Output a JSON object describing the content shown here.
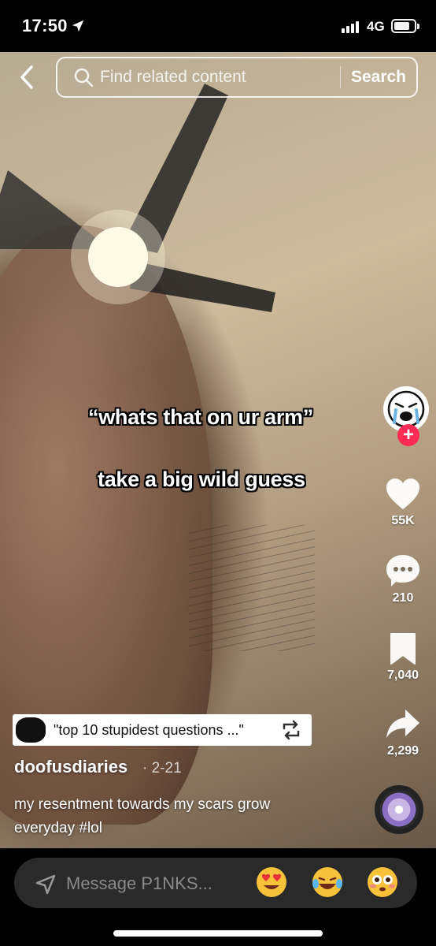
{
  "status_bar": {
    "time": "17:50",
    "network": "4G",
    "battery_level": 0.78
  },
  "search": {
    "placeholder": "Find related content",
    "button_label": "Search"
  },
  "video": {
    "captions": [
      "“whats that on ur arm”",
      "take a big wild guess"
    ]
  },
  "actions": {
    "likes": "55K",
    "comments": "210",
    "saves": "7,040",
    "shares": "2,299"
  },
  "post": {
    "linked_video": "\"top 10 stupidest questions ...\"",
    "username": "doofusdiaries",
    "date": "· 2-21",
    "description": "my resentment towards my scars grow everyday #lol"
  },
  "message_bar": {
    "placeholder": "Message P1NKS..."
  },
  "icons": {
    "back": "chevron-left-icon",
    "search": "search-icon",
    "like": "heart-icon",
    "comment": "comment-bubble-icon",
    "save": "bookmark-icon",
    "share": "share-arrow-icon",
    "repost": "repost-icon",
    "send": "send-icon",
    "emojis": [
      "heart-eyes-emoji",
      "laughing-tears-emoji",
      "flushed-emoji"
    ]
  },
  "colors": {
    "accent": "#fe2c55",
    "message_bar_bg": "#2a2a2a"
  }
}
